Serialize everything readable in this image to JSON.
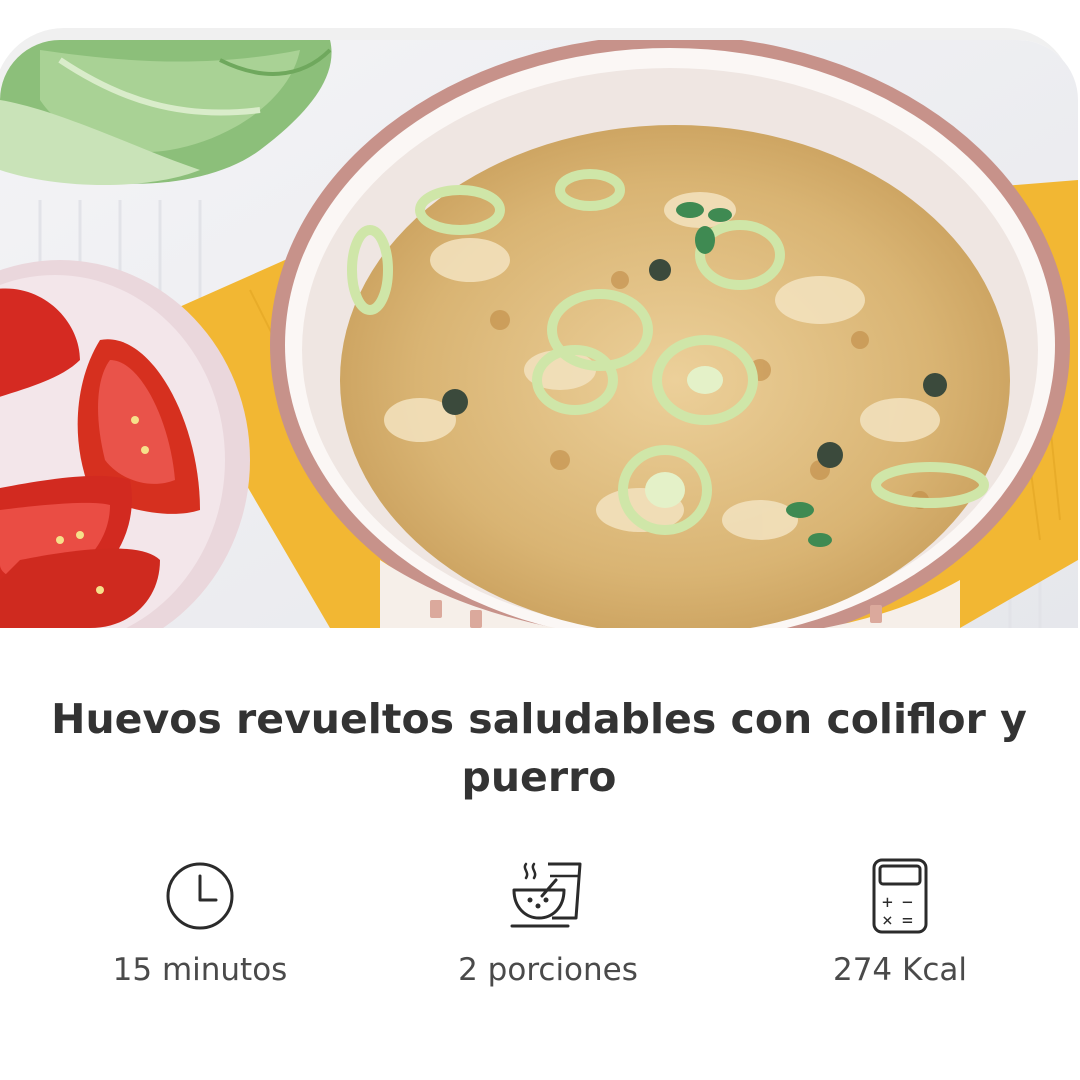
{
  "recipe": {
    "title": "Huevos revueltos saludables con coliflor y puerro",
    "photo_subject": "scrambled eggs with cauliflower and leek in a bowl"
  },
  "stats": [
    {
      "icon": "clock-icon",
      "label": "15 minutos"
    },
    {
      "icon": "servings-icon",
      "label": "2 porciones"
    },
    {
      "icon": "calculator-icon",
      "label": "274 Kcal"
    }
  ],
  "colors": {
    "title": "#333333",
    "label": "#4a4a4a",
    "icon_stroke": "#2b2b2b",
    "placemat": "#f2b733",
    "bowl_rim": "#c7928a"
  }
}
